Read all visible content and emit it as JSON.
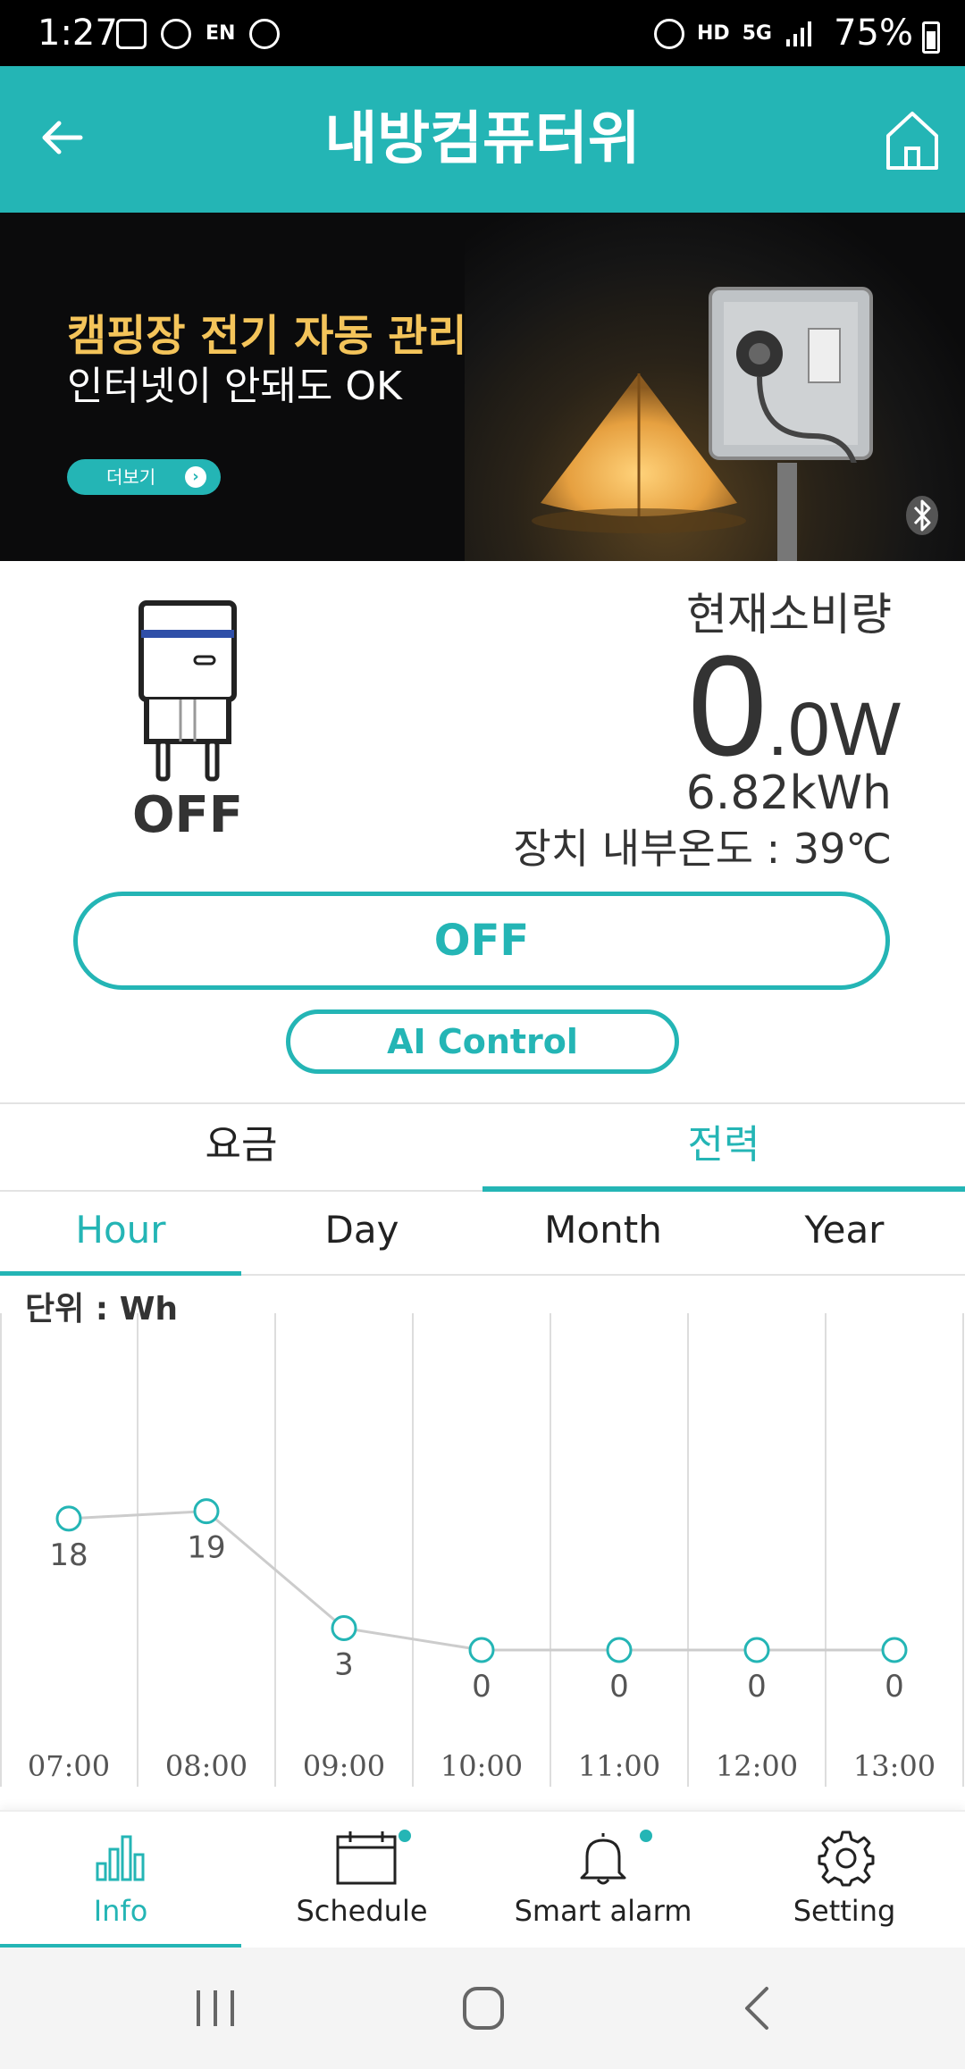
{
  "status_bar": {
    "time": "1:27",
    "battery": "75%",
    "icons_left": [
      "gallery-icon",
      "vpn-icon",
      "lang-en-icon",
      "accessibility-icon"
    ],
    "icons_right": [
      "alarm-icon",
      "hd-voice-icon",
      "5g-icon",
      "signal-icon"
    ]
  },
  "header": {
    "title": "내방컴퓨터위",
    "back_icon": "arrow-left-icon",
    "home_icon": "home-icon",
    "color": "#24b5b5"
  },
  "banner": {
    "headline": "캠핑장 전기 자동 관리",
    "subline": "인터넷이 안돼도 OK",
    "more_label": "더보기",
    "more_arrow": "›",
    "headline_color": "#f4c45a"
  },
  "device": {
    "plug_state": "OFF",
    "usage_label": "현재소비량",
    "power_integer": "0",
    "power_decimal": ".0",
    "power_unit": "W",
    "energy": "6.82kWh",
    "temperature": "장치 내부온도 : 39℃"
  },
  "buttons": {
    "power_toggle": "OFF",
    "ai_control": "AI Control"
  },
  "tabs_primary": {
    "items": [
      "요금",
      "전력"
    ],
    "selected": 1
  },
  "tabs_period": {
    "items": [
      "Hour",
      "Day",
      "Month",
      "Year"
    ],
    "selected": 0
  },
  "chart_unit": "단위 : Wh",
  "chart_data": {
    "type": "line",
    "categories": [
      "07:00",
      "08:00",
      "09:00",
      "10:00",
      "11:00",
      "12:00",
      "13:00"
    ],
    "values": [
      18,
      19,
      3,
      0,
      0,
      0,
      0
    ],
    "ylim": [
      0,
      40
    ],
    "grid": true,
    "line_color": "#cccccc",
    "marker_color": "#24b5b5"
  },
  "bottom_nav": {
    "items": [
      {
        "label": "Info",
        "icon": "bar-chart-icon",
        "active": true
      },
      {
        "label": "Schedule",
        "icon": "calendar-icon",
        "badge": true
      },
      {
        "label": "Smart alarm",
        "icon": "bell-icon",
        "badge": true
      },
      {
        "label": "Setting",
        "icon": "gear-icon"
      }
    ]
  },
  "system_nav": [
    "recents-icon",
    "home-circle-icon",
    "back-chevron-icon"
  ]
}
